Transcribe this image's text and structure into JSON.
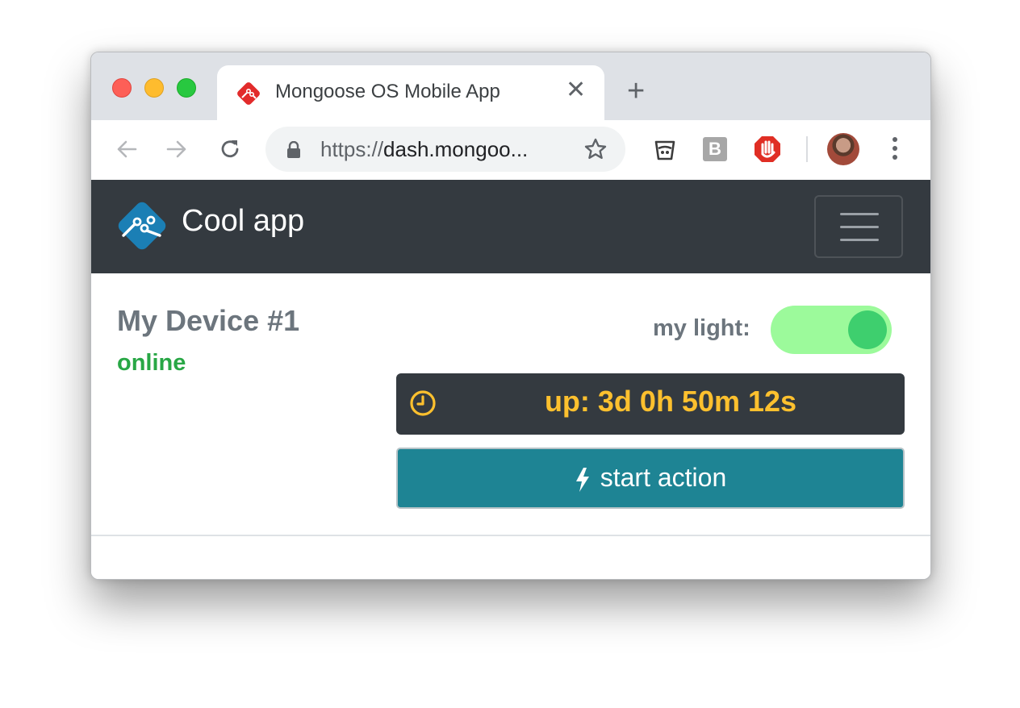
{
  "browser": {
    "tab_title": "Mongoose OS Mobile App",
    "close_glyph": "✕",
    "newtab_glyph": "+",
    "url_scheme": "https://",
    "url_host": "dash.mongoo...",
    "icons": [
      "back-arrow-icon",
      "forward-arrow-icon",
      "reload-icon",
      "lock-icon",
      "star-icon",
      "bucket-extension-icon",
      "b-extension-icon",
      "adblock-extension-icon",
      "avatar",
      "more-menu-icon"
    ],
    "ext_b_label": "B"
  },
  "app": {
    "brand": "Cool app",
    "brand_color": "#1b7fb5",
    "navbar_color": "#343a40"
  },
  "device": {
    "name": "My Device #1",
    "status": "online",
    "status_color": "#28a745"
  },
  "controls": {
    "light_label": "my light:",
    "light_on": true,
    "uptime": "up: 3d 0h 50m 12s",
    "action_label": "start action",
    "action_color": "#1e8494"
  }
}
